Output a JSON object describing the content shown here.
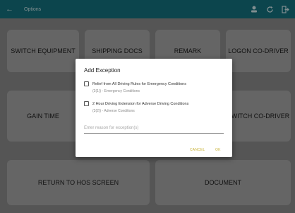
{
  "appbar": {
    "title": "Options",
    "back_icon": "arrow-left-icon",
    "actions": [
      "user-icon",
      "refresh-icon",
      "logout-icon"
    ]
  },
  "tiles": {
    "switch_equipment": "SWITCH EQUIPMENT",
    "shipping_docs": "SHIPPING DOCS",
    "remark": "REMARK",
    "logon_co_driver": "LOGON CO-DRIVER",
    "gain_time": "GAIN TIME",
    "switch_co_driver": "SWITCH CO-DRIVER",
    "return_to_hos": "RETURN TO HOS SCREEN",
    "document": "DOCUMENT"
  },
  "dialog": {
    "title": "Add Exception",
    "options": [
      {
        "label": "Relief from All Driving Rules for Emergency Conditions",
        "sub": "(3(1)) - Emergency Conditions",
        "checked": false
      },
      {
        "label": "2 Hour Driving Extension for Adverse Driving Conditions",
        "sub": "(3(2)) - Adverse Conditions",
        "checked": false
      }
    ],
    "reason_placeholder": "Enter reason for exception(s)",
    "cancel_label": "CANCEL",
    "ok_label": "OK"
  },
  "colors": {
    "appbar": "#14707d",
    "accent_button": "#c9b33a"
  }
}
